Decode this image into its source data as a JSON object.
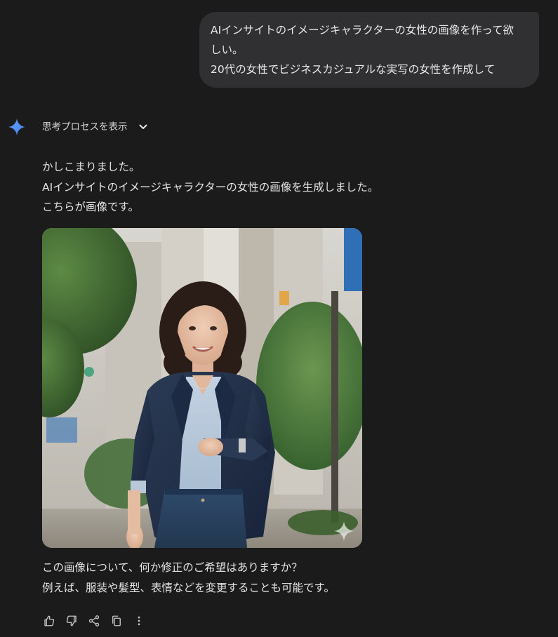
{
  "user_message": {
    "lines": [
      "AIインサイトのイメージキャラクターの女性の画像を作って欲",
      "しい。",
      "20代の女性でビジネスカジュアルな実写の女性を作成して"
    ]
  },
  "thinking": {
    "label": "思考プロセスを表示",
    "icon": "chevron-down-icon"
  },
  "reply": {
    "lines": [
      "かしこまりました。",
      "AIインサイトのイメージキャラクターの女性の画像を生成しました。",
      "こちらが画像です。"
    ]
  },
  "generated_image": {
    "subject": "Young woman in navy blazer and light blue blouse walking on a city street"
  },
  "followup": {
    "lines": [
      "この画像について、何か修正のご希望はありますか？",
      "例えば、服装や髪型、表情などを変更することも可能です。"
    ]
  },
  "actions": [
    "thumbs-up-icon",
    "thumbs-down-icon",
    "share-icon",
    "copy-icon",
    "more-vert-icon"
  ],
  "colors": {
    "background": "#1b1b1c",
    "bubble": "#303033",
    "text": "#e3e3e3",
    "gemini_blue": "#4b8df8"
  }
}
